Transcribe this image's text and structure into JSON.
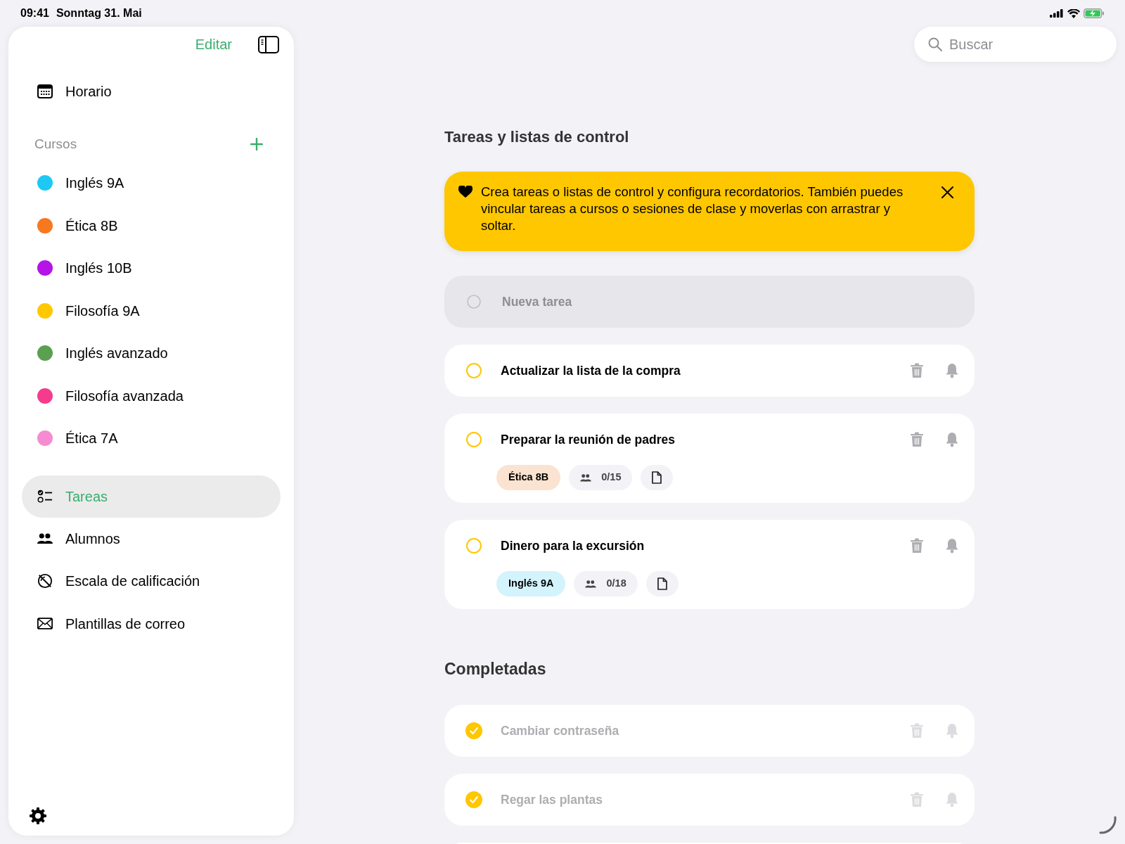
{
  "status_bar": {
    "time": "09:41",
    "date": "Sonntag 31. Mai"
  },
  "sidebar": {
    "edit_label": "Editar",
    "schedule": {
      "label": "Horario"
    },
    "courses_header": "Cursos",
    "courses": [
      {
        "label": "Inglés 9A",
        "color": "#1ec8f5"
      },
      {
        "label": "Ética 8B",
        "color": "#f7781e"
      },
      {
        "label": "Inglés 10B",
        "color": "#b414e6"
      },
      {
        "label": "Filosofía 9A",
        "color": "#ffc800"
      },
      {
        "label": "Inglés avanzado",
        "color": "#5aa050"
      },
      {
        "label": "Filosofía avanzada",
        "color": "#f53c8c"
      },
      {
        "label": "Ética 7A",
        "color": "#f58cd2"
      }
    ],
    "nav": [
      {
        "label": "Tareas",
        "kind": "tasks",
        "selected": true
      },
      {
        "label": "Alumnos",
        "kind": "students",
        "selected": false
      },
      {
        "label": "Escala de calificación",
        "kind": "grading",
        "selected": false
      },
      {
        "label": "Plantillas de correo",
        "kind": "mail",
        "selected": false
      }
    ]
  },
  "search": {
    "placeholder": "Buscar"
  },
  "heading": "Tareas y listas de control",
  "banner": {
    "text": "Crea tareas o listas de control y configura recordatorios. También puedes vincular tareas a cursos o sesiones de clase y moverlas con arrastrar y soltar."
  },
  "new_task": {
    "placeholder": "Nueva tarea"
  },
  "tasks": [
    {
      "title": "Actualizar la lista de la compra",
      "checked": false
    },
    {
      "title": "Preparar la reunión de padres",
      "checked": false,
      "course": {
        "label": "Ética 8B",
        "color": "#fae3d0"
      },
      "students": "0/15"
    },
    {
      "title": "Dinero para la excursión",
      "checked": false,
      "course": {
        "label": "Inglés 9A",
        "color": "#d3f3fd"
      },
      "students": "0/18"
    }
  ],
  "completed_heading": "Completadas",
  "completed": [
    {
      "title": "Cambiar contraseña",
      "checked": true
    },
    {
      "title": "Regar las plantas",
      "checked": true
    }
  ]
}
